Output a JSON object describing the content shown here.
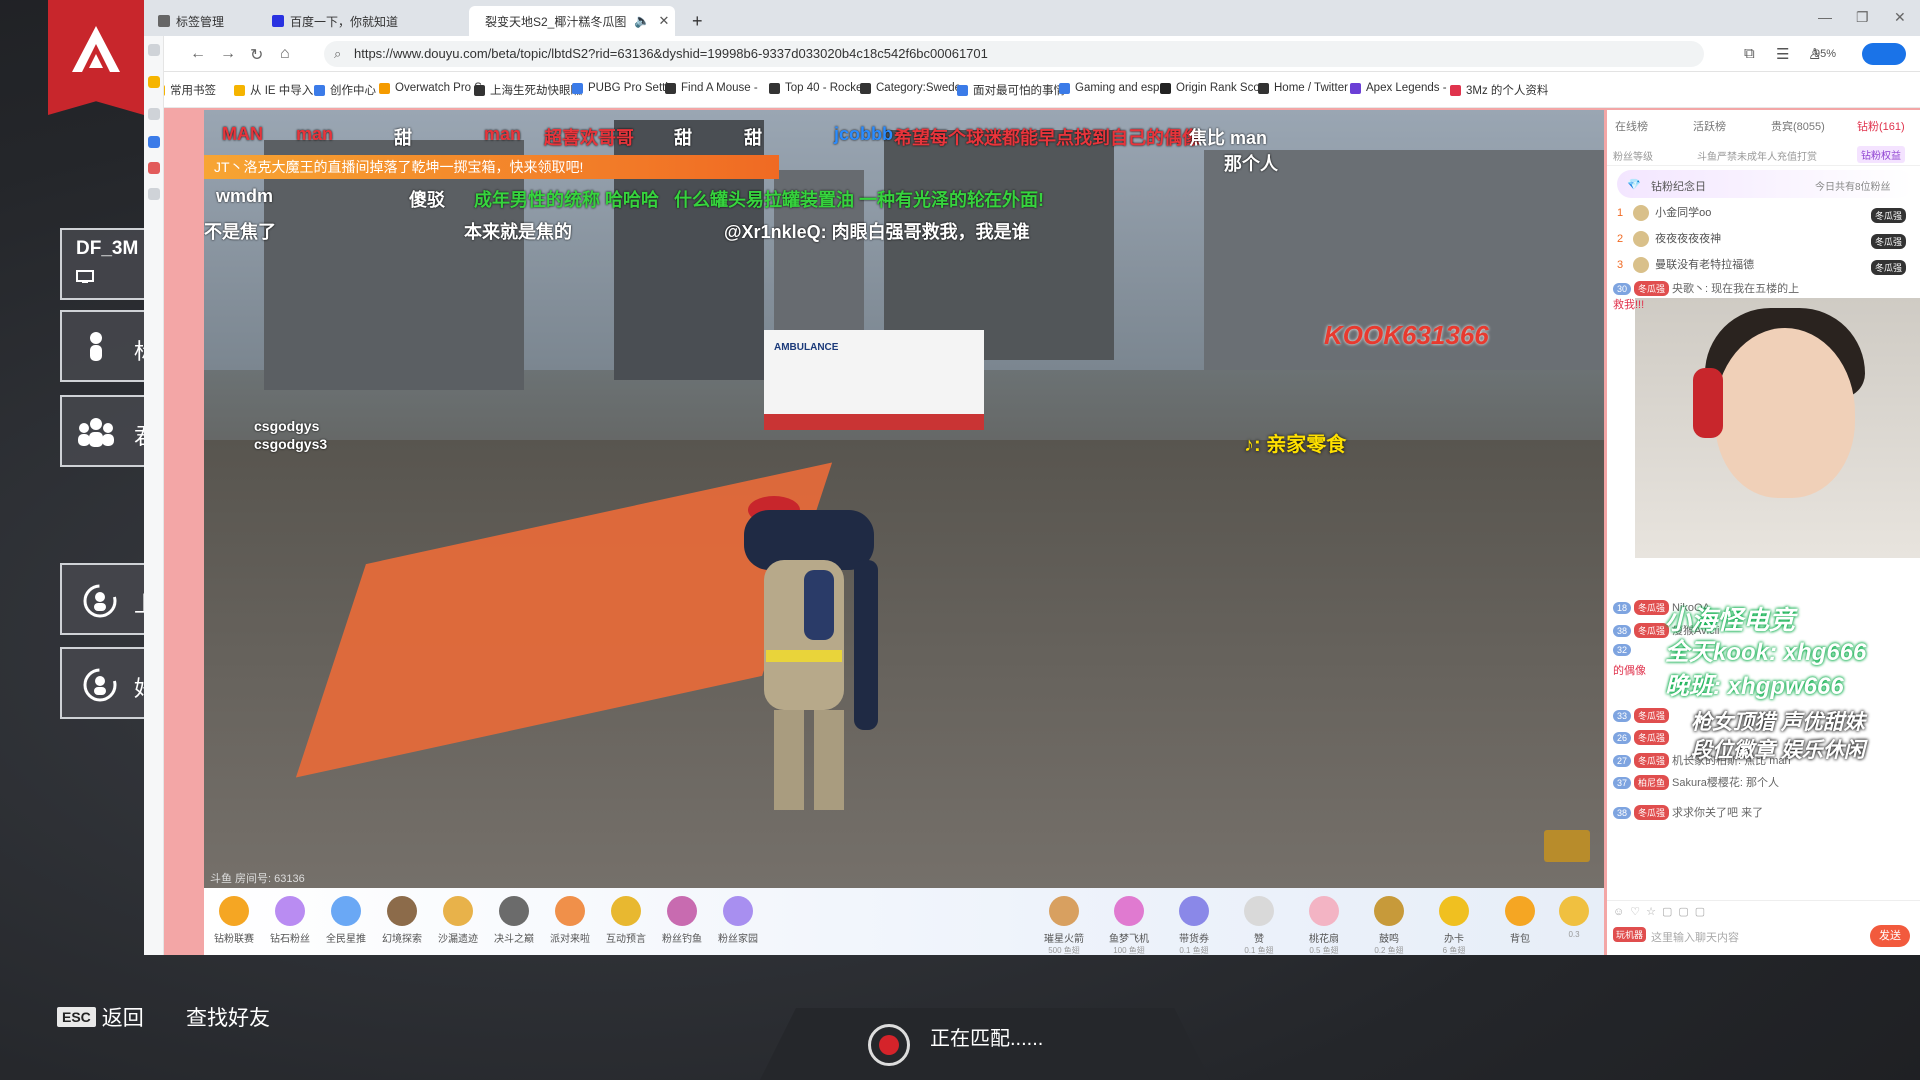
{
  "game": {
    "tiles": [
      {
        "label": "DF_3M",
        "icon": "monitor-icon"
      },
      {
        "label": "",
        "icon": "person-icon",
        "suffix": "标"
      },
      {
        "label": "",
        "icon": "group-icon",
        "suffix": "君"
      },
      {
        "label": "",
        "icon": "refresh-person-icon",
        "suffix": "上"
      },
      {
        "label": "",
        "icon": "refresh-person-icon",
        "suffix": "好"
      }
    ],
    "esc_key": "ESC",
    "esc_label": "返回",
    "find_friends": "查找好友",
    "matching": "正在匹配......"
  },
  "browser": {
    "tabs": [
      {
        "label": "标签管理"
      },
      {
        "label": "百度一下，你就知道"
      },
      {
        "label": "裂变天地S2_椰汁糕冬瓜图"
      }
    ],
    "url": "https://www.douyu.com/beta/topic/lbtdS2?rid=63136&dyshid=19998b6-9337d033020b4c18c542f6bc00061701",
    "zoom": "95%",
    "bookmarks": [
      {
        "label": "常用书签",
        "color": "#f5b400"
      },
      {
        "label": "从 IE 中导入",
        "color": "#f5b400"
      },
      {
        "label": "创作中心",
        "color": "#3b7be8"
      },
      {
        "label": "Overwatch Pro S",
        "color": "#f59b00"
      },
      {
        "label": "上海生死劫快眼瞧",
        "color": "#333"
      },
      {
        "label": "PUBG Pro Settin",
        "color": "#3b7be8"
      },
      {
        "label": "Find A Mouse -",
        "color": "#333"
      },
      {
        "label": "Top 40 - Rocket",
        "color": "#333"
      },
      {
        "label": "Category:Swede",
        "color": "#333"
      },
      {
        "label": "面对最可怕的事情",
        "color": "#3b7be8"
      },
      {
        "label": "Gaming and esp",
        "color": "#3b7be8"
      },
      {
        "label": "Origin Rank Sco",
        "color": "#222"
      },
      {
        "label": "Home / Twitter",
        "color": "#333"
      },
      {
        "label": "Apex Legends -",
        "color": "#6b3fd6"
      },
      {
        "label": "3Mz 的个人资料",
        "color": "#e0334d"
      }
    ]
  },
  "stream": {
    "gift_banner": "JT丶洛克大魔王的直播间掉落了乾坤一掷宝箱，快来领取吧!",
    "danmu": [
      {
        "text": "MAN",
        "color": "#e8343b"
      },
      {
        "text": "man",
        "color": "#e8343b"
      },
      {
        "text": "甜",
        "color": "#ffffff"
      },
      {
        "text": "man",
        "color": "#e8343b"
      },
      {
        "text": "超喜欢哥哥",
        "color": "#e8343b"
      },
      {
        "text": "甜",
        "color": "#ffffff"
      },
      {
        "text": "甜",
        "color": "#ffffff"
      },
      {
        "text": "jcobbb",
        "color": "#2a8cff"
      },
      {
        "text": "希望每个球迷都能早点找到自己的偶像",
        "color": "#e8343b"
      },
      {
        "text": "焦比 man",
        "color": "#ffffff"
      },
      {
        "text": "那个人",
        "color": "#ffffff"
      },
      {
        "text": "成年男性的统称 哈哈哈",
        "color": "#36d33d"
      },
      {
        "text": "什么罐头易拉罐装置油 一种有光泽的轮",
        "color": "#36d33d"
      },
      {
        "text": "在外面!",
        "color": "#36d33d"
      },
      {
        "text": "傻驳",
        "color": "#ffffff"
      },
      {
        "text": "wmdm",
        "color": "#ffffff"
      },
      {
        "text": "不是焦了",
        "color": "#ffffff"
      },
      {
        "text": "本来就是焦的",
        "color": "#ffffff"
      },
      {
        "text": "@Xr1nkleQ: 肉眼白强哥救我，我是谁",
        "color": "#ffffff"
      }
    ],
    "watermark": "KOOK631366",
    "tiktok": ": 亲家零食",
    "viewers": [
      "csgodgys",
      "csgodgys3"
    ],
    "room_id": "斗鱼 房间号: 63136",
    "ambulance": "AMBULANCE"
  },
  "giftbar": {
    "left": [
      "钻粉联赛",
      "钻石粉丝",
      "全民星推",
      "幻境探索",
      "沙漏遗迹",
      "决斗之巅",
      "派对来啦",
      "互动预言",
      "粉丝钓鱼",
      "粉丝家园"
    ],
    "right": [
      {
        "name": "璀星火箭",
        "price": "500 鱼翅"
      },
      {
        "name": "鱼梦飞机",
        "price": "100 鱼翅"
      },
      {
        "name": "带货券",
        "price": "0.1 鱼翅"
      },
      {
        "name": "赞",
        "price": "0.1 鱼翅"
      },
      {
        "name": "桃花扇",
        "price": "0.5 鱼翅"
      },
      {
        "name": "鼓鸣",
        "price": "0.2 鱼翅"
      },
      {
        "name": "办卡",
        "price": "6 鱼翅"
      }
    ],
    "backpack": "背包",
    "backpack_num": "0.3"
  },
  "panel": {
    "tabs": [
      "在线榜",
      "活跃榜",
      "贵宾(8055)",
      "钻粉(161)"
    ],
    "fan_level": "粉丝等级",
    "fan_notice": "斗鱼严禁未成年人充值打赏",
    "fan_benefit": "钻粉权益",
    "diamond_day": "钻粉纪念日",
    "diamond_today": "今日共有8位粉丝",
    "ranking": [
      {
        "rank": "1",
        "name": "小金同学oo",
        "badge": "冬瓜强"
      },
      {
        "rank": "2",
        "name": "夜夜夜夜夜神",
        "badge": "冬瓜强"
      },
      {
        "rank": "3",
        "name": "曼联没有老特拉福德",
        "badge": "冬瓜强"
      }
    ],
    "chat": [
      {
        "lv": "30",
        "fan": "冬瓜强",
        "text": "央歌丶: 现在我在五楼的上"
      },
      {
        "lv": "",
        "fan": "",
        "text": "救我!!!"
      },
      {
        "lv": "18",
        "fan": "冬瓜强",
        "text": "NikoOA"
      },
      {
        "lv": "38",
        "fan": "冬瓜强",
        "text": "瘦猴Avicii"
      },
      {
        "lv": "32",
        "fan": "",
        "text": ""
      },
      {
        "lv": "",
        "fan": "",
        "text": "的偶像"
      },
      {
        "lv": "33",
        "fan": "冬瓜强",
        "text": ""
      },
      {
        "lv": "26",
        "fan": "冬瓜强",
        "text": ""
      },
      {
        "lv": "27",
        "fan": "冬瓜强",
        "text": "机长家的柏斯: 焦比 man"
      },
      {
        "lv": "37",
        "fan": "柏尼鱼",
        "text": "Sakura樱樱花: 那个人"
      },
      {
        "lv": "38",
        "fan": "冬瓜强",
        "text": "求求你关了吧 来了"
      }
    ],
    "promo": [
      "小海怪电竞",
      "全天kook: xhg666",
      "晚班: xhgpw666",
      "枪女顶猎 声优甜妹",
      "段位徽章 娱乐休闲"
    ],
    "input_placeholder": "这里输入聊天内容",
    "send": "发送",
    "player_btn": "玩机器"
  }
}
